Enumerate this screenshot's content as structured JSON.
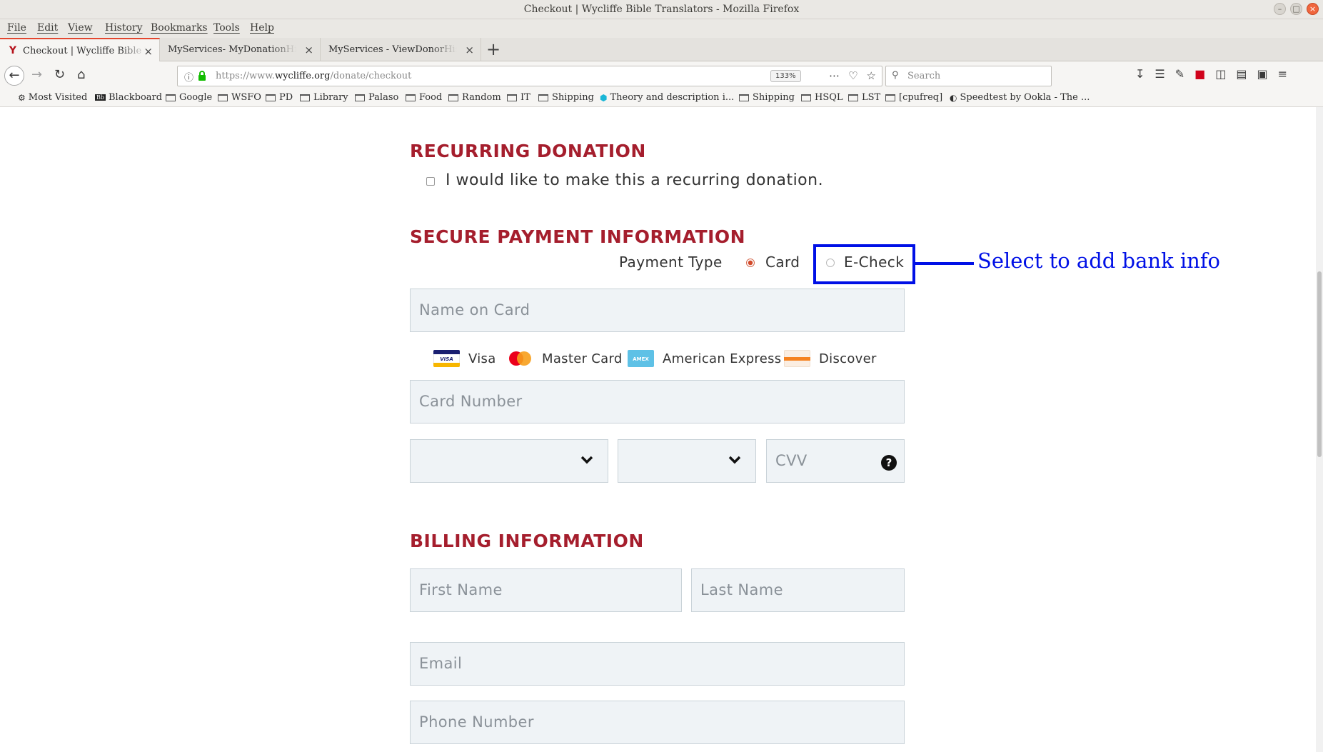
{
  "window": {
    "title": "Checkout | Wycliffe Bible Translators - Mozilla Firefox",
    "minimize": "–",
    "maximize": "□",
    "close": "×"
  },
  "menu": [
    "File",
    "Edit",
    "View",
    "History",
    "Bookmarks",
    "Tools",
    "Help"
  ],
  "tabs": [
    {
      "label": "Checkout | Wycliffe Bible Translators",
      "active": true,
      "favicon": "wycliffe-logo"
    },
    {
      "label": "MyServices- MyDonationHistory",
      "active": false
    },
    {
      "label": "MyServices - ViewDonorHistory",
      "active": false
    }
  ],
  "tab_close_glyph": "×",
  "new_tab_glyph": "+",
  "nav": {
    "url_prefix": "https://www.",
    "url_host": "wycliffe.org",
    "url_path": "/donate/checkout",
    "zoom": "133%",
    "search_placeholder": "Search"
  },
  "bookmarks": [
    {
      "label": "Most Visited",
      "icon": "gear-icon"
    },
    {
      "label": "Blackboard",
      "icon": "bb-icon"
    },
    {
      "label": "Google",
      "icon": "folder-icon"
    },
    {
      "label": "WSFO",
      "icon": "folder-icon"
    },
    {
      "label": "PD",
      "icon": "folder-icon"
    },
    {
      "label": "Library",
      "icon": "folder-icon"
    },
    {
      "label": "Palaso",
      "icon": "folder-icon"
    },
    {
      "label": "Food",
      "icon": "folder-icon"
    },
    {
      "label": "Random",
      "icon": "folder-icon"
    },
    {
      "label": "IT",
      "icon": "folder-icon"
    },
    {
      "label": "Shipping",
      "icon": "folder-icon"
    },
    {
      "label": "Theory and description i...",
      "icon": "cube-icon"
    },
    {
      "label": "Shipping",
      "icon": "folder-icon"
    },
    {
      "label": "HSQL",
      "icon": "folder-icon"
    },
    {
      "label": "LST",
      "icon": "folder-icon"
    },
    {
      "label": "[cpufreq]",
      "icon": "folder-icon"
    },
    {
      "label": "Speedtest by Ookla - The ...",
      "icon": "speedometer-icon"
    }
  ],
  "recurring": {
    "heading": "RECURRING DONATION",
    "checkbox_label": "I would like to make this a recurring donation."
  },
  "payment": {
    "heading": "SECURE PAYMENT INFORMATION",
    "type_label": "Payment Type",
    "options": [
      "Card",
      "E-Check"
    ],
    "selected": "Card",
    "name_placeholder": "Name on Card",
    "cards": [
      "Visa",
      "Master Card",
      "American Express",
      "Discover"
    ],
    "card_number_placeholder": "Card Number",
    "cvv_placeholder": "CVV",
    "help_glyph": "?"
  },
  "annotation": {
    "text": "Select to add bank info",
    "color": "#0010e6"
  },
  "billing": {
    "heading": "BILLING INFORMATION",
    "first_name_placeholder": "First Name",
    "last_name_placeholder": "Last Name",
    "email_placeholder": "Email",
    "phone_placeholder": "Phone Number"
  },
  "colors": {
    "heading": "#a51e2d",
    "field_bg": "#eff3f6",
    "tab_accent": "#e3472f"
  }
}
